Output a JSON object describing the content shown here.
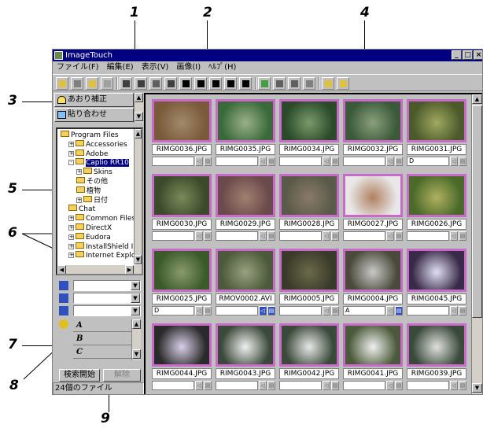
{
  "callouts": [
    "1",
    "2",
    "3",
    "4",
    "5",
    "6",
    "7",
    "8",
    "9"
  ],
  "window": {
    "title": "ImageTouch",
    "min_glyph": "_",
    "max_glyph": "□",
    "close_glyph": "×"
  },
  "menu": [
    "ファイル(F)",
    "編集(E)",
    "表示(V)",
    "画像(I)",
    "ﾍﾙﾌﾟ(H)"
  ],
  "toolbar_icons": [
    "open-icon",
    "folder-icon",
    "copy-icon",
    "rotate-icon",
    "filter-icon",
    "sort-icon",
    "frame-icon",
    "rect-select-icon",
    "line-icon",
    "square-icon",
    "grid-2-icon",
    "grid-3-icon",
    "grid-4-icon",
    "edit-icon",
    "copy-image-icon",
    "stack-icon",
    "list-icon",
    "help-icon",
    "context-help-icon"
  ],
  "left_buttons": {
    "correct": "あおり補正",
    "paste": "貼り合わせ"
  },
  "tree": [
    {
      "label": "Program Files",
      "pm": "",
      "depth": 0
    },
    {
      "label": "Accessories",
      "pm": "+",
      "depth": 1
    },
    {
      "label": "Adobe",
      "pm": "+",
      "depth": 1
    },
    {
      "label": "Caplio RR10",
      "pm": "-",
      "depth": 1
    },
    {
      "label": "Skins",
      "pm": "+",
      "depth": 2
    },
    {
      "label": "その他",
      "pm": "",
      "depth": 2
    },
    {
      "label": "植物",
      "pm": "",
      "depth": 2
    },
    {
      "label": "日付",
      "pm": "+",
      "depth": 2
    },
    {
      "label": "Chat",
      "pm": "",
      "depth": 1
    },
    {
      "label": "Common Files",
      "pm": "+",
      "depth": 1
    },
    {
      "label": "DirectX",
      "pm": "+",
      "depth": 1
    },
    {
      "label": "Eudora",
      "pm": "+",
      "depth": 1
    },
    {
      "label": "InstallShield Ins",
      "pm": "+",
      "depth": 1
    },
    {
      "label": "Internet Explore",
      "pm": "+",
      "depth": 1
    }
  ],
  "keywords": [
    "A",
    "B",
    "C"
  ],
  "search_buttons": {
    "start": "検索開始",
    "clear": "解除"
  },
  "status_text": "24個のファイル",
  "thumbnails": [
    {
      "name": "RIMG0036.JPG",
      "note": "",
      "c1": "#7a5a3a",
      "c2": "#a08a6a"
    },
    {
      "name": "RIMG0035.JPG",
      "note": "",
      "c1": "#3a6a3a",
      "c2": "#9ab08a"
    },
    {
      "name": "RIMG0034.JPG",
      "note": "",
      "c1": "#2a4a2a",
      "c2": "#7a9a6a"
    },
    {
      "name": "RIMG0032.JPG",
      "note": "",
      "c1": "#3a5a3a",
      "c2": "#8aa07a"
    },
    {
      "name": "RIMG0031.JPG",
      "note": "D",
      "c1": "#4a5a2a",
      "c2": "#a0a860"
    },
    {
      "name": "RIMG0030.JPG",
      "note": "",
      "c1": "#3a4a2a",
      "c2": "#7a8a5a"
    },
    {
      "name": "RIMG0029.JPG",
      "note": "",
      "c1": "#6a4a4a",
      "c2": "#a08070"
    },
    {
      "name": "RIMG0028.JPG",
      "note": "",
      "c1": "#5a5a4a",
      "c2": "#8a7a6a"
    },
    {
      "name": "RIMG0027.JPG",
      "note": "",
      "c1": "#e8e8e8",
      "c2": "#b08060"
    },
    {
      "name": "RIMG0026.JPG",
      "note": "",
      "c1": "#4a6a2a",
      "c2": "#b0b060"
    },
    {
      "name": "RIMG0025.JPG",
      "note": "D",
      "c1": "#3a5a2a",
      "c2": "#8a9a6a"
    },
    {
      "name": "RMOV0002.AVI",
      "note": "",
      "c1": "#4a5a3a",
      "c2": "#9aa080"
    },
    {
      "name": "RIMG0005.JPG",
      "note": "",
      "c1": "#3a3a2a",
      "c2": "#6a6a4a"
    },
    {
      "name": "RIMG0004.JPG",
      "note": "A",
      "c1": "#4a4a3a",
      "c2": "#c8c8c8"
    },
    {
      "name": "RIMG0045.JPG",
      "note": "",
      "c1": "#3a2a4a",
      "c2": "#e0e0f0"
    },
    {
      "name": "RIMG0044.JPG",
      "note": "",
      "c1": "#2a2a2a",
      "c2": "#d8d0e8"
    },
    {
      "name": "RIMG0043.JPG",
      "note": "",
      "c1": "#3a4a3a",
      "c2": "#f0f0f0"
    },
    {
      "name": "RIMG0042.JPG",
      "note": "",
      "c1": "#3a4a3a",
      "c2": "#e8e8e8"
    },
    {
      "name": "RIMG0041.JPG",
      "note": "",
      "c1": "#4a5a3a",
      "c2": "#f0f0f0"
    },
    {
      "name": "RIMG0039.JPG",
      "note": "",
      "c1": "#3a4a3a",
      "c2": "#e0e0e0"
    }
  ],
  "colors": {
    "selection_border": "#c86ac8",
    "titlebar": "#000080"
  }
}
